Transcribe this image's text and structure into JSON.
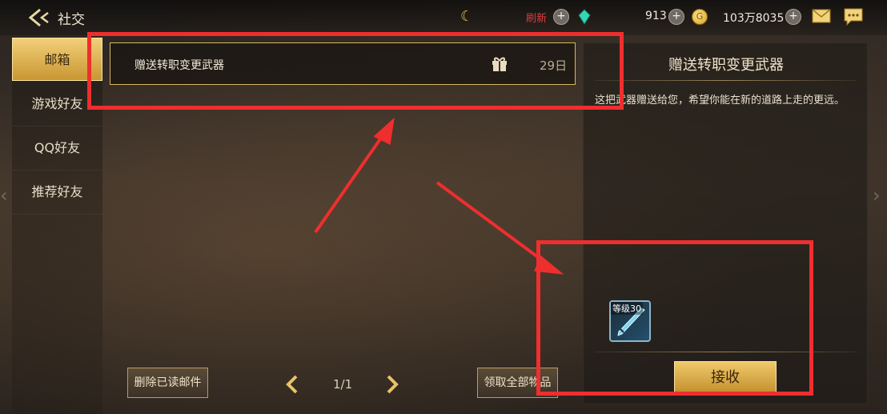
{
  "topbar": {
    "title": "社交",
    "refresh_label": "刷新",
    "currency1": "913",
    "currency2": "103万8035",
    "coin_glyph": "G"
  },
  "sidebar": {
    "items": [
      {
        "label": "邮箱",
        "active": true
      },
      {
        "label": "游戏好友",
        "active": false
      },
      {
        "label": "QQ好友",
        "active": false
      },
      {
        "label": "推荐好友",
        "active": false
      }
    ]
  },
  "mail_list": {
    "items": [
      {
        "subject": "赠送转职变更武器",
        "days_left": "29日"
      }
    ]
  },
  "detail": {
    "title": "赠送转职变更武器",
    "body": "这把武器赠送给您，希望你能在新的道路上走的更远。",
    "reward_level": "等级30",
    "receive_label": "接收"
  },
  "bottom": {
    "delete_read_label": "删除已读邮件",
    "page_indicator": "1/1",
    "claim_all_label": "领取全部物品"
  },
  "colors": {
    "accent_gold": "#d9b65f",
    "annotation_red": "#ef2e2e"
  }
}
